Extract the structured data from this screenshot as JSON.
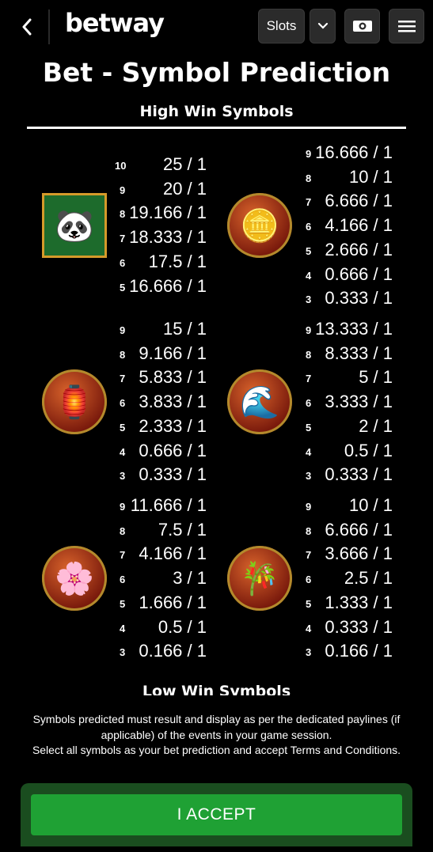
{
  "header": {
    "logo": "betway",
    "slots_label": "Slots"
  },
  "title": "Bet - Symbol Prediction",
  "section_high": "High Win Symbols",
  "section_low": "Low Win Symbols",
  "symbols": [
    {
      "name": "panda-symbol",
      "glyph": "🐼",
      "rows": [
        {
          "k": "10",
          "v": "25 / 1"
        },
        {
          "k": "9",
          "v": "20 / 1"
        },
        {
          "k": "8",
          "v": "19.166 / 1"
        },
        {
          "k": "7",
          "v": "18.333 / 1"
        },
        {
          "k": "6",
          "v": "17.5 / 1"
        },
        {
          "k": "5",
          "v": "16.666 / 1"
        }
      ]
    },
    {
      "name": "gold-ingot-symbol",
      "glyph": "🪙",
      "rows": [
        {
          "k": "9",
          "v": "16.666 / 1"
        },
        {
          "k": "8",
          "v": "10 / 1"
        },
        {
          "k": "7",
          "v": "6.666 / 1"
        },
        {
          "k": "6",
          "v": "4.166 / 1"
        },
        {
          "k": "5",
          "v": "2.666 / 1"
        },
        {
          "k": "4",
          "v": "0.666 / 1"
        },
        {
          "k": "3",
          "v": "0.333 / 1"
        }
      ]
    },
    {
      "name": "lantern-symbol",
      "glyph": "🏮",
      "rows": [
        {
          "k": "9",
          "v": "15 / 1"
        },
        {
          "k": "8",
          "v": "9.166 / 1"
        },
        {
          "k": "7",
          "v": "5.833 / 1"
        },
        {
          "k": "6",
          "v": "3.833 / 1"
        },
        {
          "k": "5",
          "v": "2.333 / 1"
        },
        {
          "k": "4",
          "v": "0.666 / 1"
        },
        {
          "k": "3",
          "v": "0.333 / 1"
        }
      ]
    },
    {
      "name": "waterfall-symbol",
      "glyph": "🌊",
      "rows": [
        {
          "k": "9",
          "v": "13.333 / 1"
        },
        {
          "k": "8",
          "v": "8.333 / 1"
        },
        {
          "k": "7",
          "v": "5 / 1"
        },
        {
          "k": "6",
          "v": "3.333 / 1"
        },
        {
          "k": "5",
          "v": "2 / 1"
        },
        {
          "k": "4",
          "v": "0.5 / 1"
        },
        {
          "k": "3",
          "v": "0.333 / 1"
        }
      ]
    },
    {
      "name": "blossom-symbol",
      "glyph": "🌸",
      "rows": [
        {
          "k": "9",
          "v": "11.666 / 1"
        },
        {
          "k": "8",
          "v": "7.5 / 1"
        },
        {
          "k": "7",
          "v": "4.166 / 1"
        },
        {
          "k": "6",
          "v": "3 / 1"
        },
        {
          "k": "5",
          "v": "1.666 / 1"
        },
        {
          "k": "4",
          "v": "0.5 / 1"
        },
        {
          "k": "3",
          "v": "0.166 / 1"
        }
      ]
    },
    {
      "name": "bamboo-symbol",
      "glyph": "🎋",
      "rows": [
        {
          "k": "9",
          "v": "10 / 1"
        },
        {
          "k": "8",
          "v": "6.666 / 1"
        },
        {
          "k": "7",
          "v": "3.666 / 1"
        },
        {
          "k": "6",
          "v": "2.5 / 1"
        },
        {
          "k": "5",
          "v": "1.333 / 1"
        },
        {
          "k": "4",
          "v": "0.333 / 1"
        },
        {
          "k": "3",
          "v": "0.166 / 1"
        }
      ]
    }
  ],
  "footer": {
    "disclaimer_1": "Symbols predicted must result and display as per the dedicated paylines (if applicable) of the events in your game session.",
    "disclaimer_2": "Select all symbols as your bet prediction and accept Terms and Conditions.",
    "accept_label": "I ACCEPT"
  }
}
